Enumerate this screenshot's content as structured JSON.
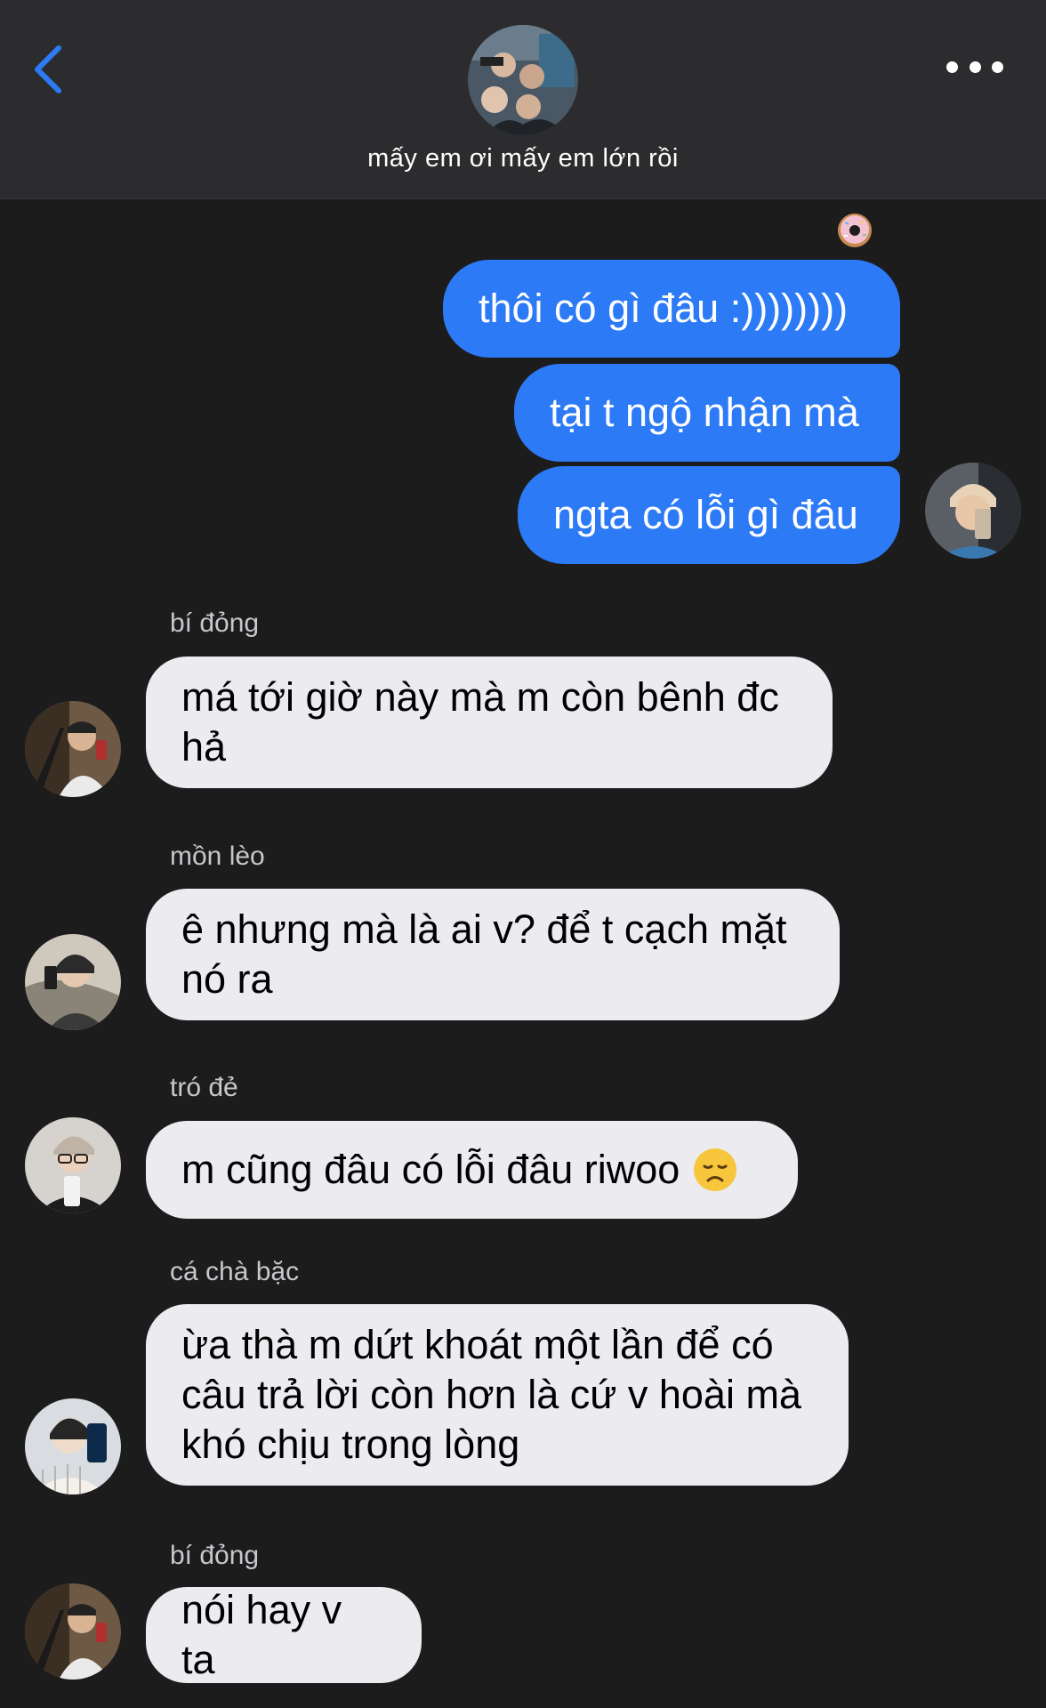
{
  "header": {
    "title": "mấy em ơi mấy em lớn rồi",
    "back_icon": "chevron-left-icon",
    "more_icon": "more-horizontal-icon",
    "accent_color": "#2d7af6"
  },
  "outgoing": {
    "reaction_icon": "donut-emoji",
    "messages": [
      "thôi có gì đâu :))))))))",
      "tại t ngộ nhận mà",
      "ngta có lỗi gì đâu"
    ]
  },
  "incoming": [
    {
      "sender": "bí đỏng",
      "text": "má tới giờ này mà m còn bênh đc hả"
    },
    {
      "sender": "mồn lèo",
      "text": "ê nhưng mà là ai v? để t cạch mặt nó ra"
    },
    {
      "sender": "tró đẻ",
      "text": "m cũng đâu có lỗi đâu riwoo",
      "emoji": "disappointed-face-emoji"
    },
    {
      "sender": "cá chà bặc",
      "text": "ừa thà m dứt khoát một lần để có câu trả lời còn hơn là cứ v hoài mà khó chịu trong lòng"
    },
    {
      "sender": "bí đỏng",
      "text": "nói hay v ta"
    }
  ]
}
